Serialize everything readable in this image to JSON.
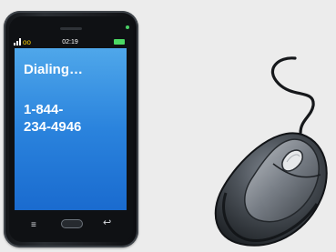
{
  "phone": {
    "status_time": "02:19",
    "screen_heading": "Dialing…",
    "number_line1": "1-844-",
    "number_line2": "234-4946",
    "screen_color": "#2a83dd"
  },
  "icons": {
    "signal": "signal-icon",
    "voicemail": "voicemail-icon",
    "battery": "battery-icon",
    "menu": "menu-icon",
    "home": "home-button",
    "back": "back-icon",
    "mouse": "computer-mouse-icon"
  }
}
